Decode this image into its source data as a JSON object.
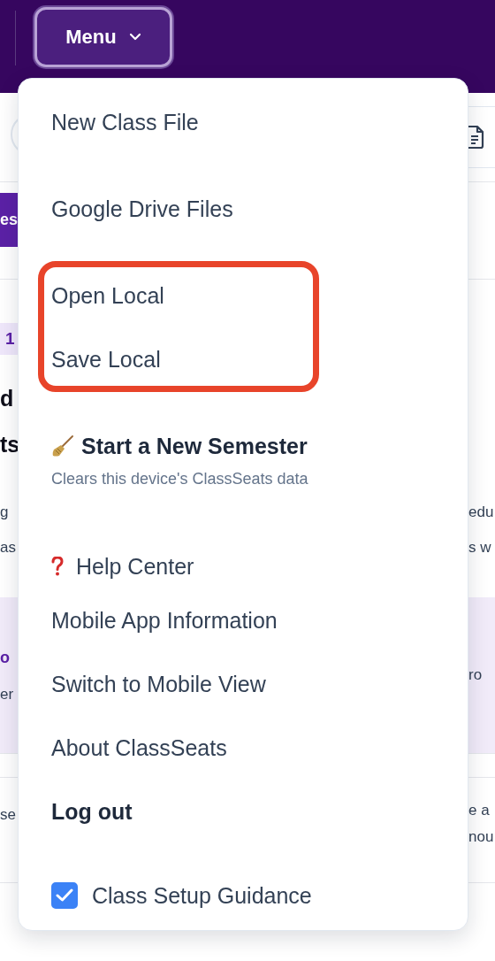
{
  "header": {
    "menu_button": "Menu",
    "menu_expanded": true
  },
  "page": {
    "tab_label": "es",
    "badge": "1",
    "heading": [
      "d",
      "ts"
    ],
    "paragraph_left": [
      "g",
      "as"
    ],
    "paragraph_right": [
      "edu",
      "s w"
    ],
    "callout": {
      "title": "o",
      "text_left": "er",
      "text_right": "ro"
    },
    "footer_left": "se",
    "footer_right": [
      "e a",
      "nou"
    ]
  },
  "menu": {
    "sections": [
      {
        "highlighted": false,
        "items": [
          {
            "kind": "item",
            "label": "New Class File"
          }
        ]
      },
      {
        "highlighted": false,
        "items": [
          {
            "kind": "item",
            "label": "Google Drive Files"
          }
        ]
      },
      {
        "highlighted": true,
        "items": [
          {
            "kind": "item",
            "label": "Open Local"
          },
          {
            "kind": "item",
            "label": "Save Local"
          }
        ]
      },
      {
        "highlighted": false,
        "items": [
          {
            "kind": "semester",
            "label": "Start a New Semester",
            "subtitle": "Clears this device's ClassSeats data"
          }
        ]
      },
      {
        "highlighted": false,
        "items": [
          {
            "kind": "help",
            "label": "Help Center"
          },
          {
            "kind": "item",
            "label": "Mobile App Information"
          },
          {
            "kind": "item",
            "label": "Switch to Mobile View"
          },
          {
            "kind": "item",
            "label": "About ClassSeats"
          },
          {
            "kind": "strong",
            "label": "Log out"
          }
        ]
      },
      {
        "highlighted": false,
        "items": [
          {
            "kind": "checkbox",
            "label": "Class Setup Guidance",
            "checked": true
          }
        ]
      }
    ]
  }
}
